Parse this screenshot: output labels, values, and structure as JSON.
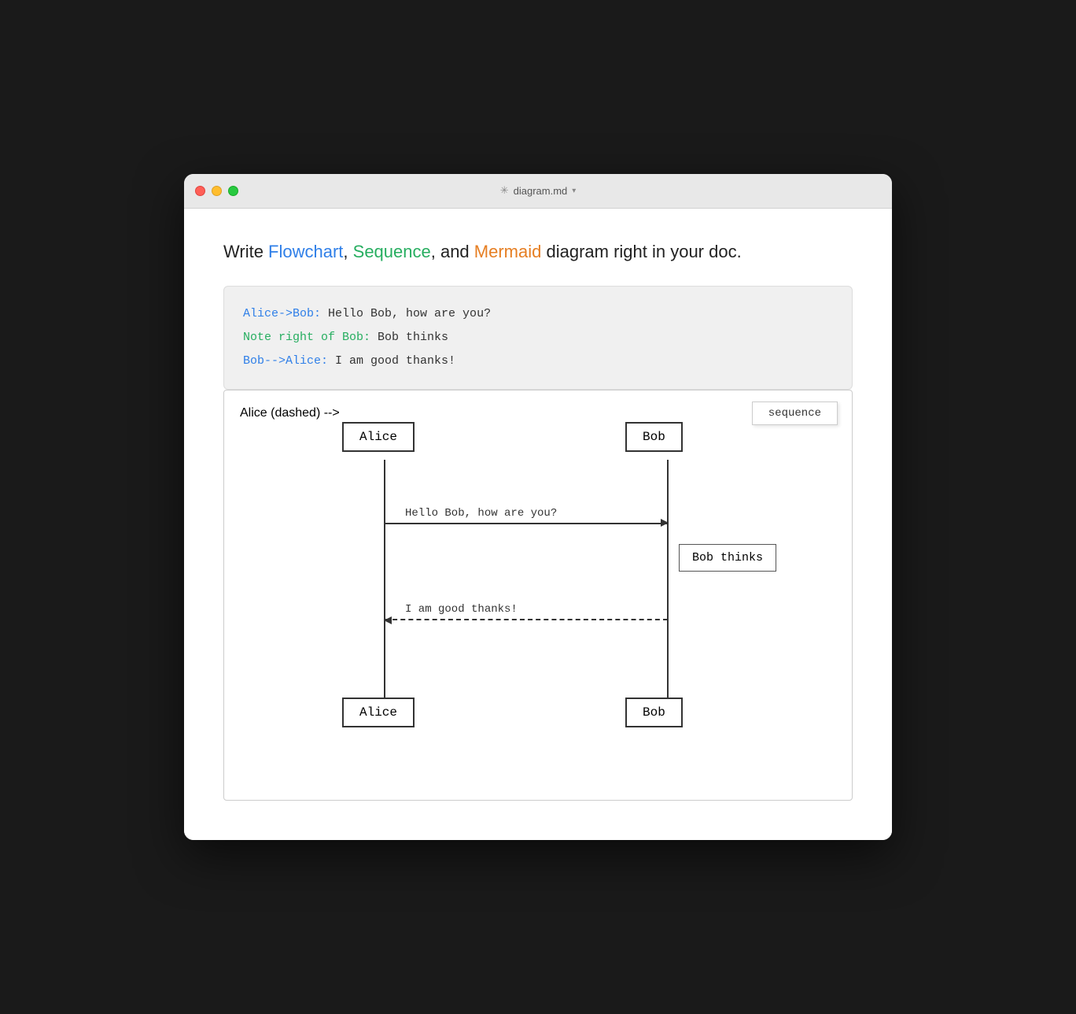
{
  "window": {
    "title": "diagram.md",
    "title_icon": "✳",
    "title_chevron": "▾"
  },
  "intro": {
    "text_before": "Write ",
    "link1": "Flowchart",
    "text_mid1": ", ",
    "link2": "Sequence",
    "text_mid2": ", and ",
    "link3": "Mermaid",
    "text_after": " diagram right in your doc."
  },
  "code": {
    "line1_prefix": "Alice->Bob:",
    "line1_text": " Hello Bob, how are you?",
    "line2_prefix": "Note right of Bob:",
    "line2_text": " Bob thinks",
    "line3_prefix": "Bob-->Alice:",
    "line3_text": " I am good thanks!"
  },
  "diagram": {
    "sequence_label": "sequence",
    "alice_top": "Alice",
    "bob_top": "Bob",
    "msg1": "Hello Bob, how are you?",
    "note": "Bob thinks",
    "msg2": "I am good thanks!",
    "alice_bottom": "Alice",
    "bob_bottom": "Bob"
  }
}
